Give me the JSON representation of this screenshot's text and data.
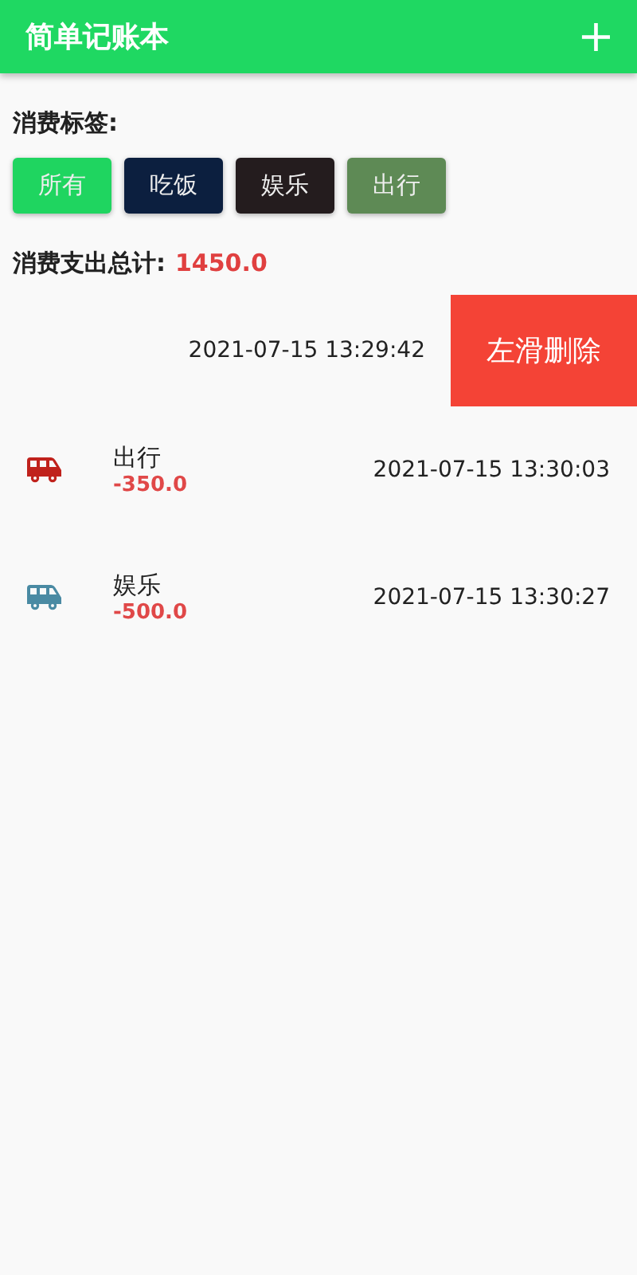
{
  "app_bar": {
    "title": "简单记账本",
    "action": "+"
  },
  "tags_label": "消费标签:",
  "tags": [
    {
      "label": "所有",
      "color": "#1fd560"
    },
    {
      "label": "吃饭",
      "color": "#0c1f3f"
    },
    {
      "label": "娱乐",
      "color": "#241c1e"
    },
    {
      "label": "出行",
      "color": "#5e8a55"
    }
  ],
  "total": {
    "label": "消费支出总计:",
    "value": "1450.0"
  },
  "records": [
    {
      "kind": "swiped",
      "time": "2021-07-15 13:29:42",
      "action": "左滑删除"
    },
    {
      "kind": "normal",
      "color": "#c0221c",
      "name": "出行",
      "amount": "-350.0",
      "time": "2021-07-15 13:30:03"
    },
    {
      "kind": "normal",
      "color": "#4a8aa3",
      "name": "娱乐",
      "amount": "-500.0",
      "time": "2021-07-15 13:30:27"
    }
  ]
}
